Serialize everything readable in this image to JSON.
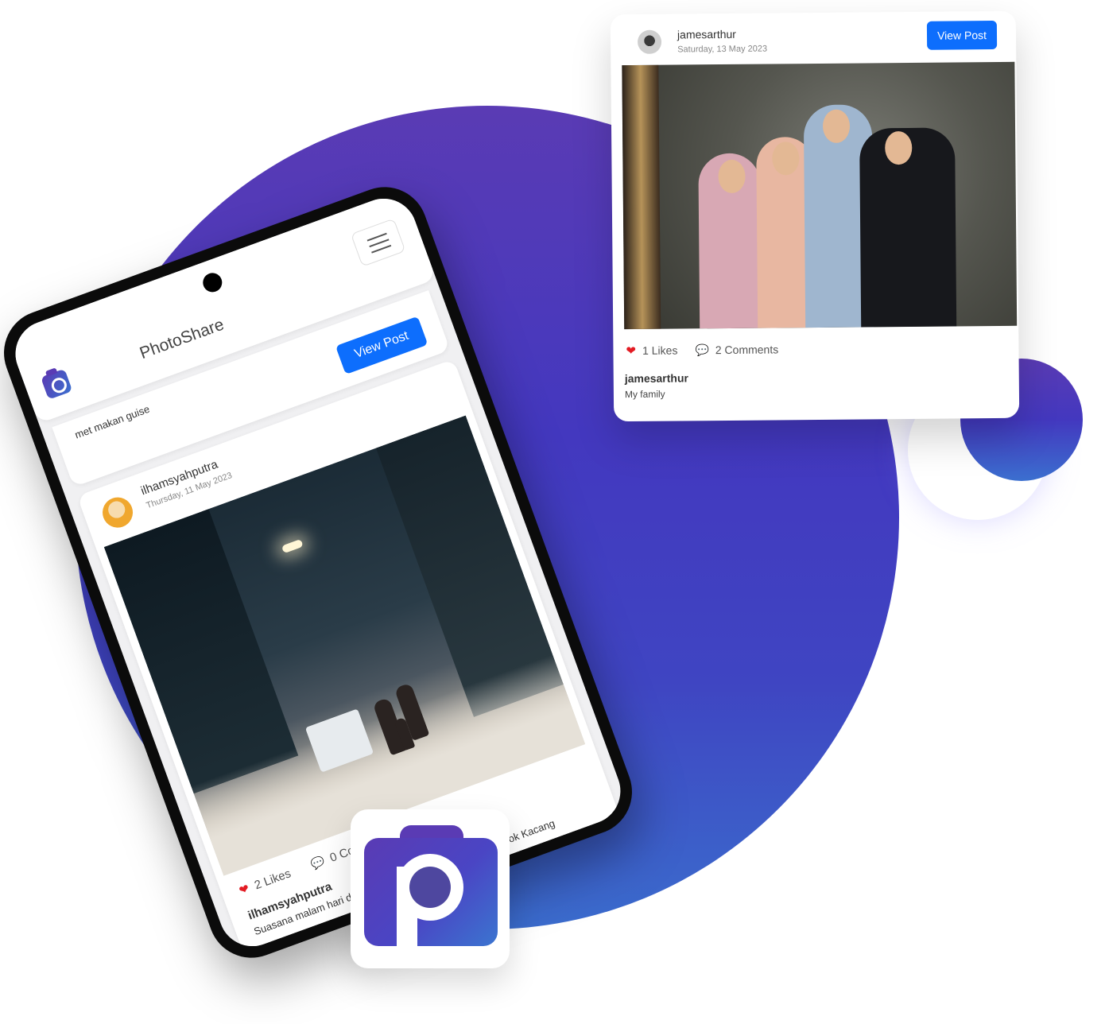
{
  "app": {
    "title": "PhotoShare"
  },
  "phone": {
    "previous_post": {
      "caption": "met makan guise",
      "view_button": "View Post"
    },
    "post": {
      "username": "ilhamsyahputra",
      "date": "Thursday, 11 May 2023",
      "likes": "2 Likes",
      "comments": "0 Comments",
      "owner": "ilhamsyahputra",
      "caption": "Suasana malam hari di depan rumah, jalan Haji Nawi Pondok Kacang"
    }
  },
  "card": {
    "username": "jamesarthur",
    "date": "Saturday, 13 May 2023",
    "view_button": "View Post",
    "likes": "1 Likes",
    "comments": "2 Comments",
    "owner": "jamesarthur",
    "caption": "My family"
  },
  "colors": {
    "brand_purple": "#5a3bb4",
    "brand_blue": "#3b6fcf",
    "button_blue": "#0d6efd",
    "like_red": "#e31b23"
  },
  "icons": [
    "photoshare-logo-icon",
    "menu-icon",
    "heart-icon",
    "comment-icon"
  ]
}
